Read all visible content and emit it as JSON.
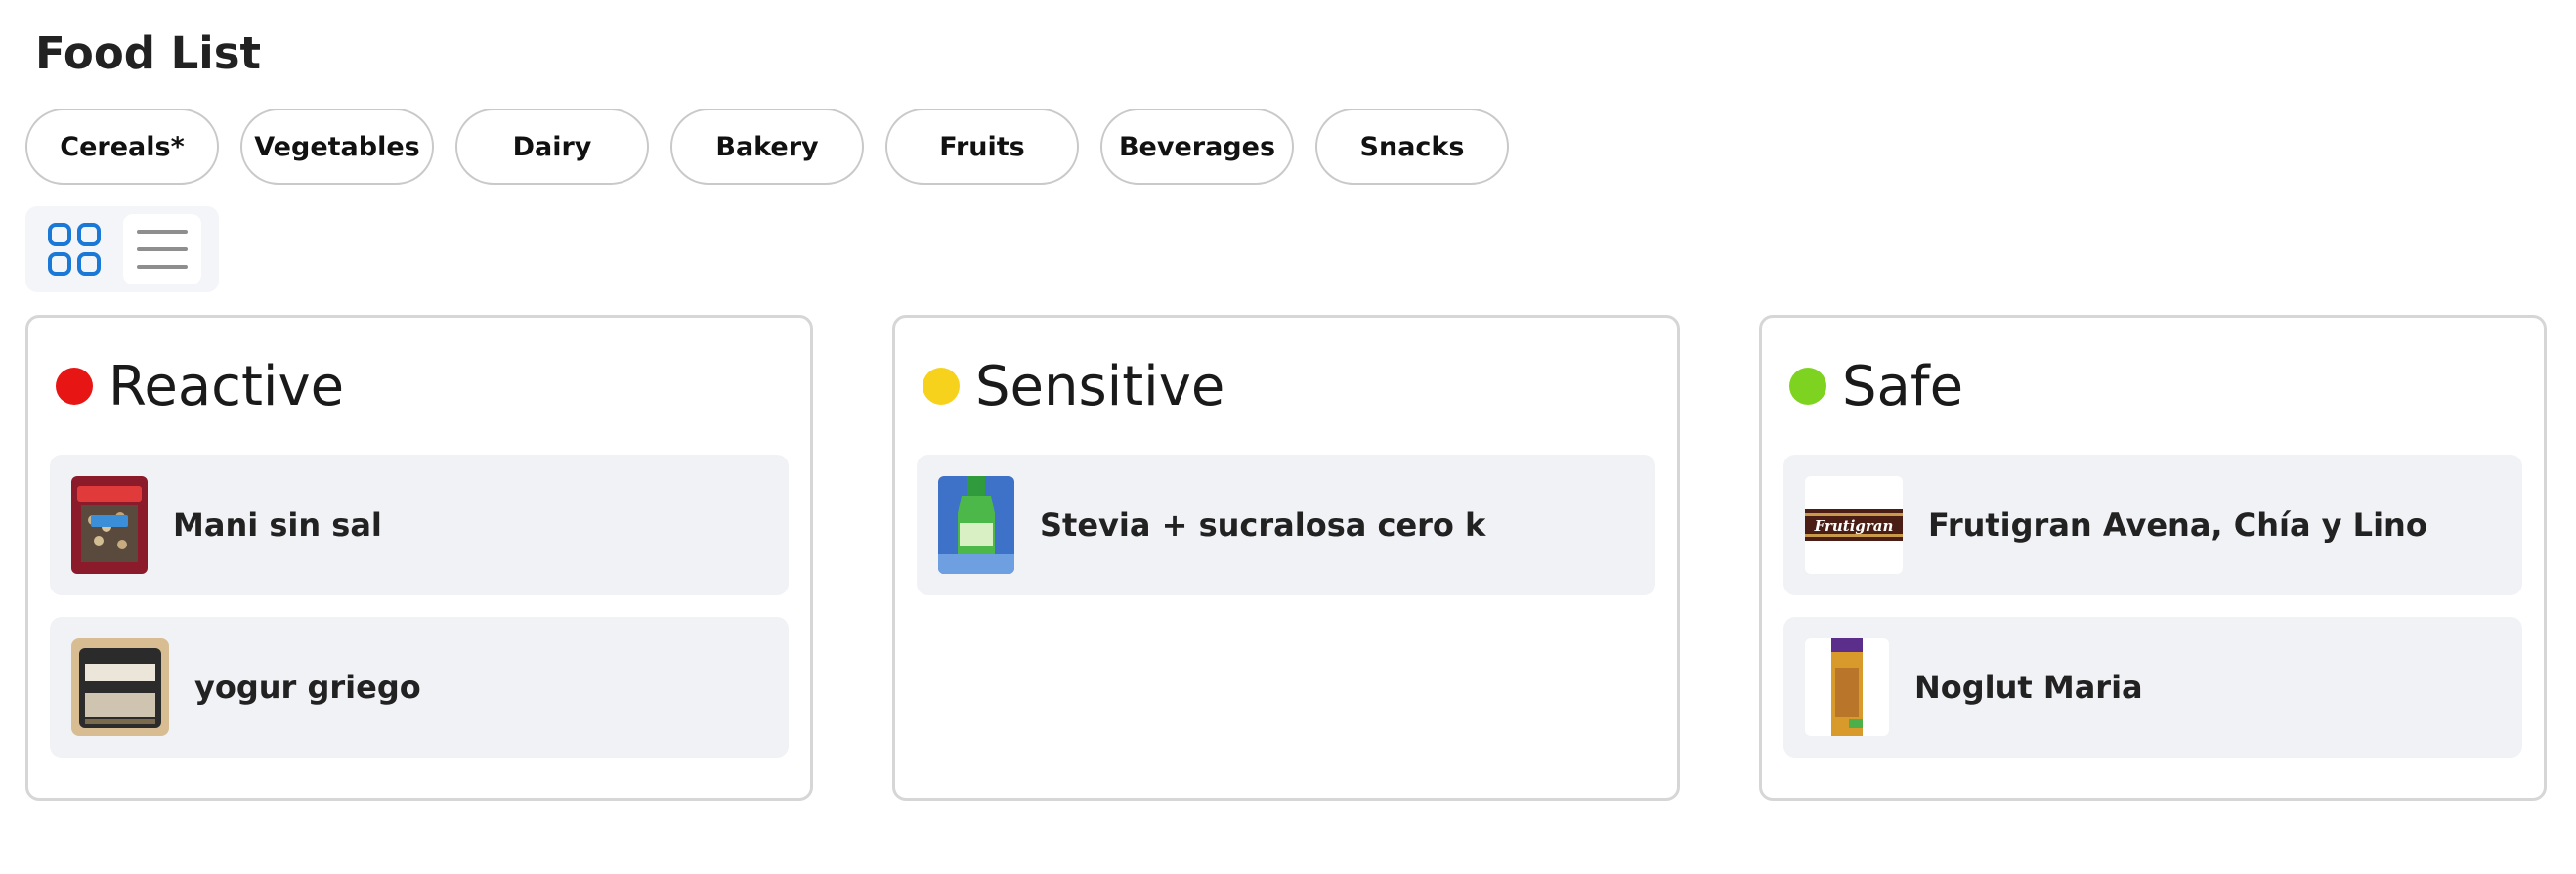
{
  "page": {
    "title": "Food List"
  },
  "filters": [
    "Cereals*",
    "Vegetables",
    "Dairy",
    "Bakery",
    "Fruits",
    "Beverages",
    "Snacks"
  ],
  "view_toggle": {
    "grid_icon": "grid-icon",
    "list_icon": "list-icon",
    "active": "grid"
  },
  "colors": {
    "reactive": "#e81515",
    "sensitive": "#f7d21c",
    "safe": "#7ed321",
    "accent": "#1a78d6"
  },
  "columns": [
    {
      "title": "Reactive",
      "items": [
        {
          "name": "Mani sin sal"
        },
        {
          "name": "yogur griego"
        }
      ]
    },
    {
      "title": "Sensitive",
      "items": [
        {
          "name": "Stevia + sucralosa cero k"
        }
      ]
    },
    {
      "title": "Safe",
      "items": [
        {
          "name": "Frutigran Avena, Chía y Lino",
          "logo_text": "Frutigran"
        },
        {
          "name": "Noglut Maria"
        }
      ]
    }
  ]
}
